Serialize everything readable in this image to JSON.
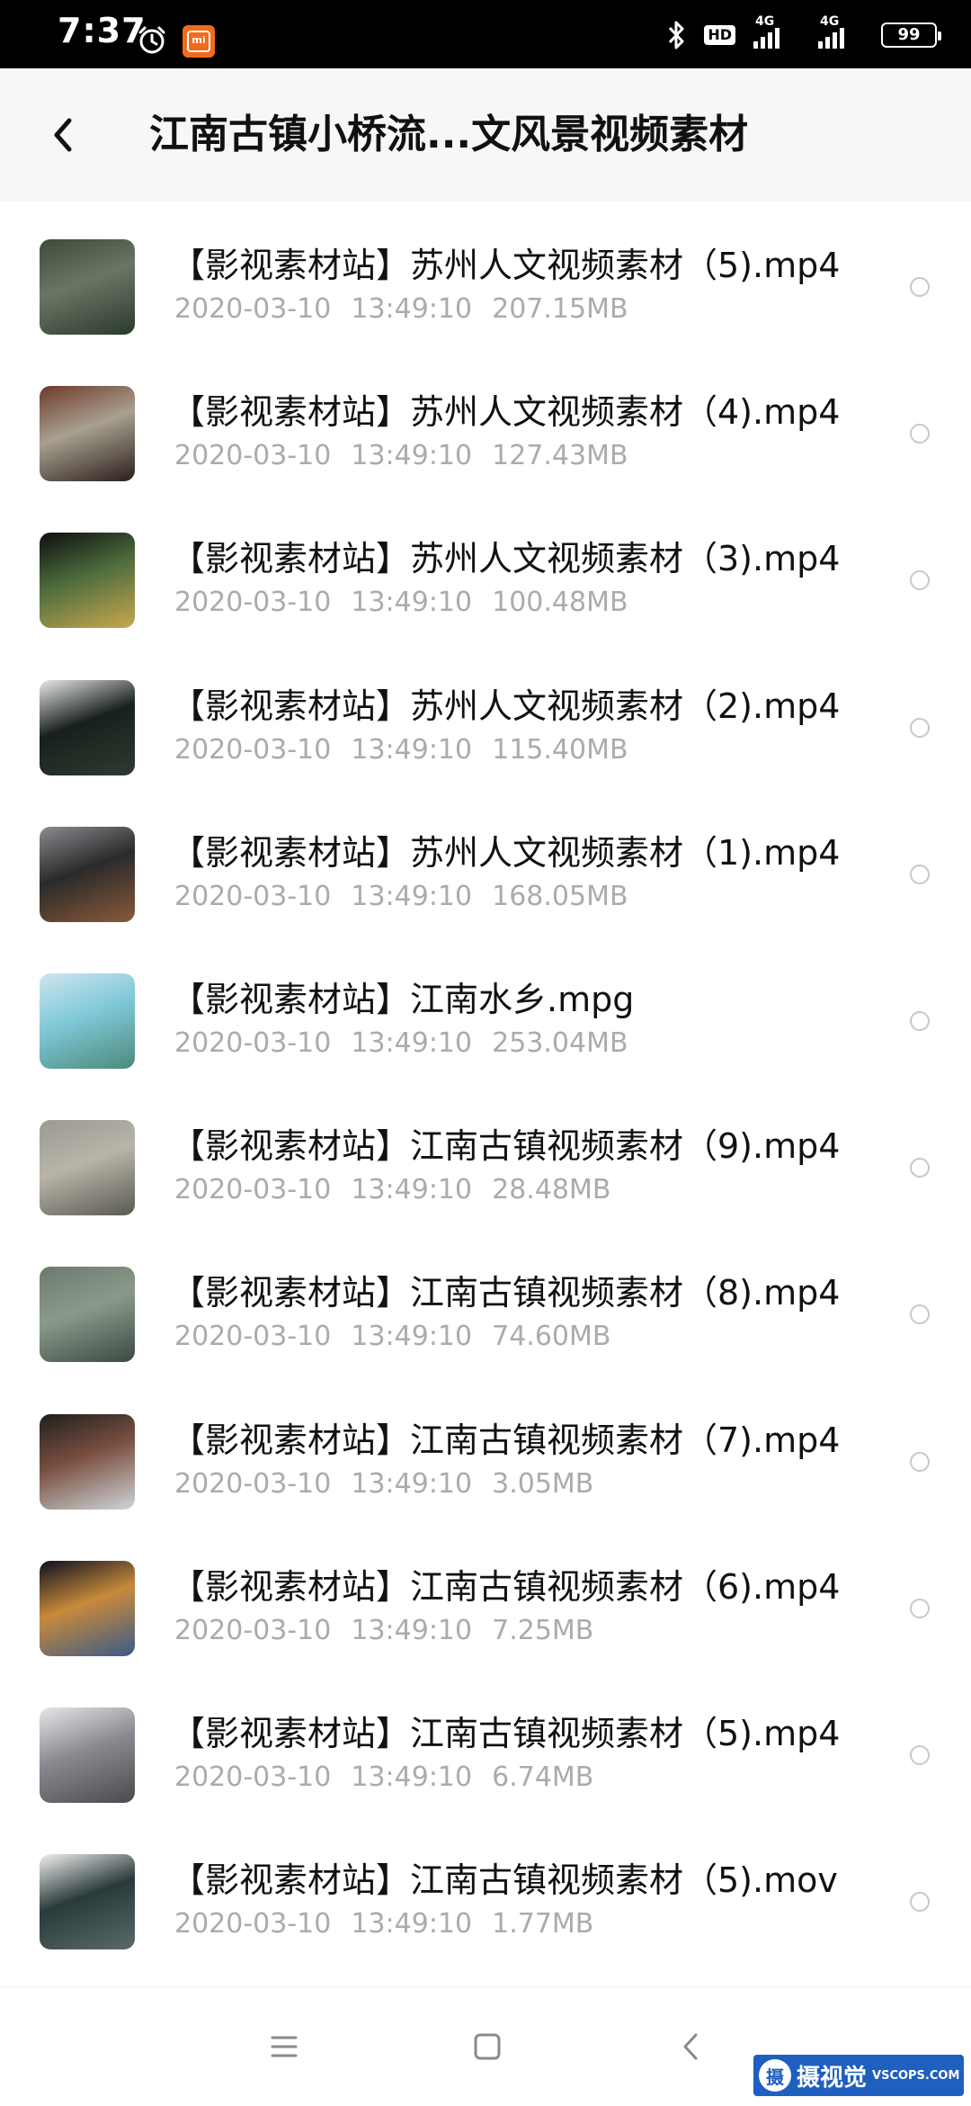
{
  "status_bar": {
    "time": "7:37",
    "hd": "HD",
    "net_1": "4G",
    "net_2": "4G",
    "battery": "99",
    "icons": [
      "alarm-icon",
      "mi-icon",
      "bluetooth-icon",
      "signal-icon",
      "battery-icon"
    ]
  },
  "header": {
    "title": "江南古镇小桥流...文风景视频素材",
    "back_icon": "chevron-left-icon"
  },
  "files": [
    {
      "name": "【影视素材站】苏州人文视频素材（5).mp4",
      "date": "2020-03-10",
      "time": "13:49:10",
      "size": "207.15MB",
      "thumb_colors": [
        "#3d4a3a",
        "#2b3a2a",
        "#6b7566"
      ]
    },
    {
      "name": "【影视素材站】苏州人文视频素材（4).mp4",
      "date": "2020-03-10",
      "time": "13:49:10",
      "size": "127.43MB",
      "thumb_colors": [
        "#6d3a2a",
        "#2a1f1c",
        "#a8a090"
      ]
    },
    {
      "name": "【影视素材站】苏州人文视频素材（3).mp4",
      "date": "2020-03-10",
      "time": "13:49:10",
      "size": "100.48MB",
      "thumb_colors": [
        "#0e0e0e",
        "#c9a84f",
        "#4c6b3c"
      ]
    },
    {
      "name": "【影视素材站】苏州人文视频素材（2).mp4",
      "date": "2020-03-10",
      "time": "13:49:10",
      "size": "115.40MB",
      "thumb_colors": [
        "#e8e8e8",
        "#2f3a32",
        "#18201b"
      ]
    },
    {
      "name": "【影视素材站】苏州人文视频素材（1).mp4",
      "date": "2020-03-10",
      "time": "13:49:10",
      "size": "168.05MB",
      "thumb_colors": [
        "#8a8c90",
        "#8a5a3a",
        "#2a2a2a"
      ]
    },
    {
      "name": "【影视素材站】江南水乡.mpg",
      "date": "2020-03-10",
      "time": "13:49:10",
      "size": "253.04MB",
      "thumb_colors": [
        "#cfe6ee",
        "#4d8a7a",
        "#7fc8d8"
      ]
    },
    {
      "name": "【影视素材站】江南古镇视频素材（9).mp4",
      "date": "2020-03-10",
      "time": "13:49:10",
      "size": "28.48MB",
      "thumb_colors": [
        "#9a9a94",
        "#5a5a52",
        "#b8b4a8"
      ]
    },
    {
      "name": "【影视素材站】江南古镇视频素材（8).mp4",
      "date": "2020-03-10",
      "time": "13:49:10",
      "size": "74.60MB",
      "thumb_colors": [
        "#6c7a6e",
        "#3a4a44",
        "#8a9a8a"
      ]
    },
    {
      "name": "【影视素材站】江南古镇视频素材（7).mp4",
      "date": "2020-03-10",
      "time": "13:49:10",
      "size": "3.05MB",
      "thumb_colors": [
        "#1e1e1e",
        "#cfd5da",
        "#7a5040"
      ]
    },
    {
      "name": "【影视素材站】江南古镇视频素材（6).mp4",
      "date": "2020-03-10",
      "time": "13:49:10",
      "size": "7.25MB",
      "thumb_colors": [
        "#0c1020",
        "#3a5a8a",
        "#c88a3a"
      ]
    },
    {
      "name": "【影视素材站】江南古镇视频素材（5).mp4",
      "date": "2020-03-10",
      "time": "13:49:10",
      "size": "6.74MB",
      "thumb_colors": [
        "#e6e6ea",
        "#4a4a4e",
        "#8a8a90"
      ]
    },
    {
      "name": "【影视素材站】江南古镇视频素材（5).mov",
      "date": "2020-03-10",
      "time": "13:49:10",
      "size": "1.77MB",
      "thumb_colors": [
        "#f0f0f0",
        "#5a6a6a",
        "#2a3a3a"
      ]
    }
  ],
  "nav_bar": {
    "icons": [
      "menu-icon",
      "home-square-icon",
      "back-triangle-icon"
    ]
  },
  "watermark": {
    "logo": "摄",
    "text_cn": "摄视觉",
    "text_en": "VSCOPS.COM"
  }
}
